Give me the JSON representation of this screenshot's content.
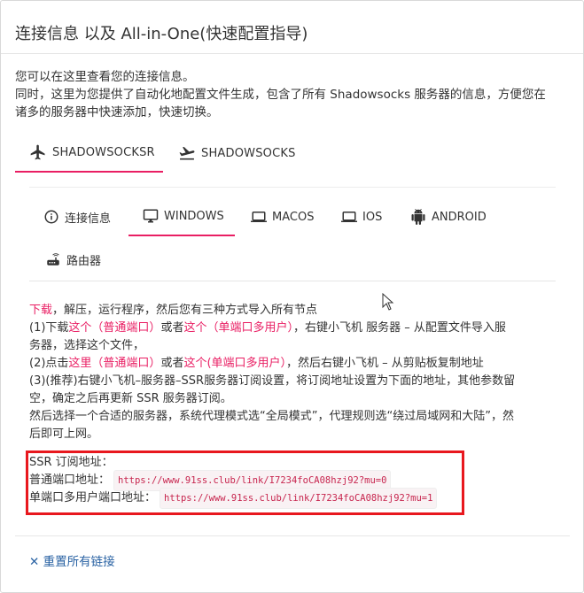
{
  "title": "连接信息 以及 All-in-One(快速配置指导)",
  "intro": {
    "line1": "您可以在这里查看您的连接信息。",
    "line2": "同时，这里为您提供了自动化地配置文件生成，包含了所有 Shadowsocks 服务器的信息，方便您在",
    "line3": "诸多的服务器中快速添加，快速切换。"
  },
  "protocol_tabs": [
    {
      "label": "SHADOWSOCKSR",
      "icon": "airplane-icon",
      "active": true
    },
    {
      "label": "SHADOWSOCKS",
      "icon": "airplane-takeoff-icon",
      "active": false
    }
  ],
  "platform_tabs": [
    {
      "label": "连接信息",
      "icon": "info-icon"
    },
    {
      "label": "WINDOWS",
      "icon": "desktop-icon",
      "active": true
    },
    {
      "label": "MACOS",
      "icon": "laptop-icon"
    },
    {
      "label": "IOS",
      "icon": "laptop-icon"
    },
    {
      "label": "ANDROID",
      "icon": "android-icon"
    },
    {
      "label": "路由器",
      "icon": "router-icon"
    }
  ],
  "guide": {
    "l1_link": "下载",
    "l1_text": "，解压，运行程序，然后您有三种方式导入所有节点",
    "l2_a": "(1)下载",
    "l2_link1": "这个（普通端口）",
    "l2_b": "或者",
    "l2_link2": "这个（单端口多用户）",
    "l2_c": "，右键小飞机 服务器 – 从配置文件导入服",
    "l3": "务器，选择这个文件，",
    "l4_a": "(2)点击",
    "l4_link1": "这里（普通端口）",
    "l4_b": "或者",
    "l4_link2": "这个(单端口多用户）",
    "l4_c": "，然后右键小飞机 – 从剪贴板复制地址",
    "l5": "(3)(推荐)右键小飞机–服务器–SSR服务器订阅设置，将订阅地址设置为下面的地址，其他参数留",
    "l6": "空，确定之后再更新 SSR 服务器订阅。",
    "l7": "然后选择一个合适的服务器，系统代理模式选“全局模式”，代理规则选“绕过局域网和大陆”，然",
    "l8": "后即可上网。"
  },
  "subscription": {
    "heading": "SSR 订阅地址：",
    "normal_label": "普通端口地址：",
    "normal_url": "https://www.91ss.club/link/I7234foCA08hzj92?mu=0",
    "multi_label": "单端口多用户端口地址：",
    "multi_url": "https://www.91ss.club/link/I7234foCA08hzj92?mu=1"
  },
  "reset_link": "重置所有链接",
  "reset_icon": "close-icon",
  "colors": {
    "accent": "#e91e63",
    "link_blue": "#2962a3",
    "highlight_box": "#e8181e"
  }
}
